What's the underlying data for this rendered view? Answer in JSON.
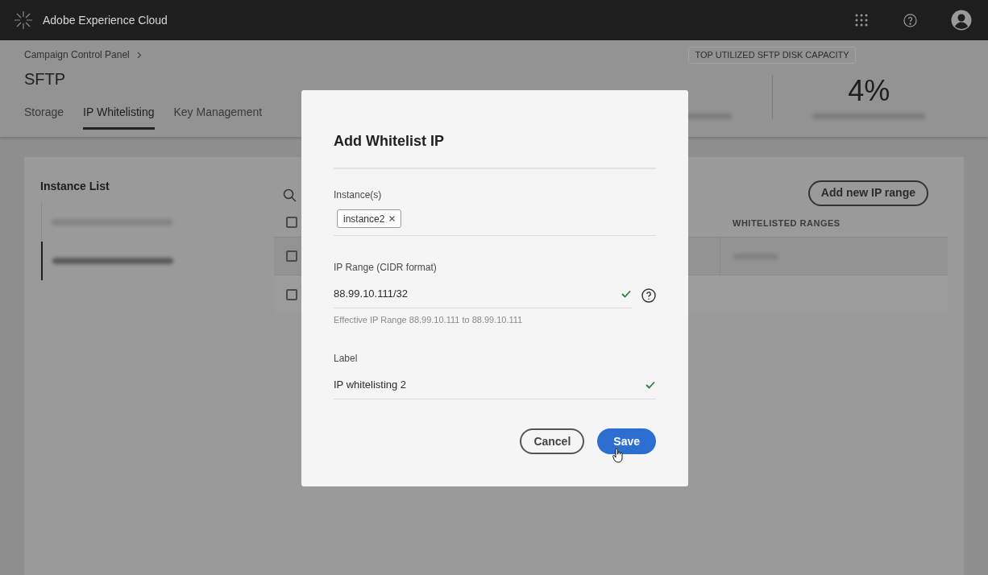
{
  "app_bar": {
    "title": "Adobe Experience Cloud"
  },
  "breadcrumb": [
    "Campaign Control Panel"
  ],
  "page_title": "SFTP",
  "tabs": [
    {
      "label": "Storage",
      "selected": false
    },
    {
      "label": "IP Whitelisting",
      "selected": true
    },
    {
      "label": "Key Management",
      "selected": false
    }
  ],
  "disk_capacity": {
    "badge": "TOP UTILIZED SFTP DISK CAPACITY",
    "stats": [
      {
        "value": "4%"
      }
    ]
  },
  "instance_list": {
    "title": "Instance List",
    "items": [
      {
        "selected": false
      },
      {
        "selected": true
      }
    ]
  },
  "table": {
    "add_button": "Add new IP range",
    "columns": [
      {
        "label": "WHITELISTED RANGES"
      }
    ],
    "select_all_checked": false,
    "rows": [
      {
        "checked": false,
        "selected": true,
        "kind": "redacted"
      },
      {
        "checked": false,
        "selected": false,
        "kind": "empty"
      }
    ]
  },
  "dialog": {
    "title": "Add Whitelist IP",
    "fields": [
      {
        "kind": "tags",
        "label": "Instance(s)",
        "tags": [
          "instance2"
        ]
      },
      {
        "kind": "text",
        "label": "IP Range (CIDR format)",
        "value": "88.99.10.111/32",
        "valid": true,
        "help": true,
        "hint": "Effective IP Range 88.99.10.111 to 88.99.10.111"
      },
      {
        "kind": "text",
        "label": "Label",
        "value": "IP whitelisting 2",
        "valid": true
      }
    ],
    "buttons": [
      {
        "label": "Cancel",
        "kind": "secondary"
      },
      {
        "label": "Save",
        "kind": "primary"
      }
    ]
  }
}
